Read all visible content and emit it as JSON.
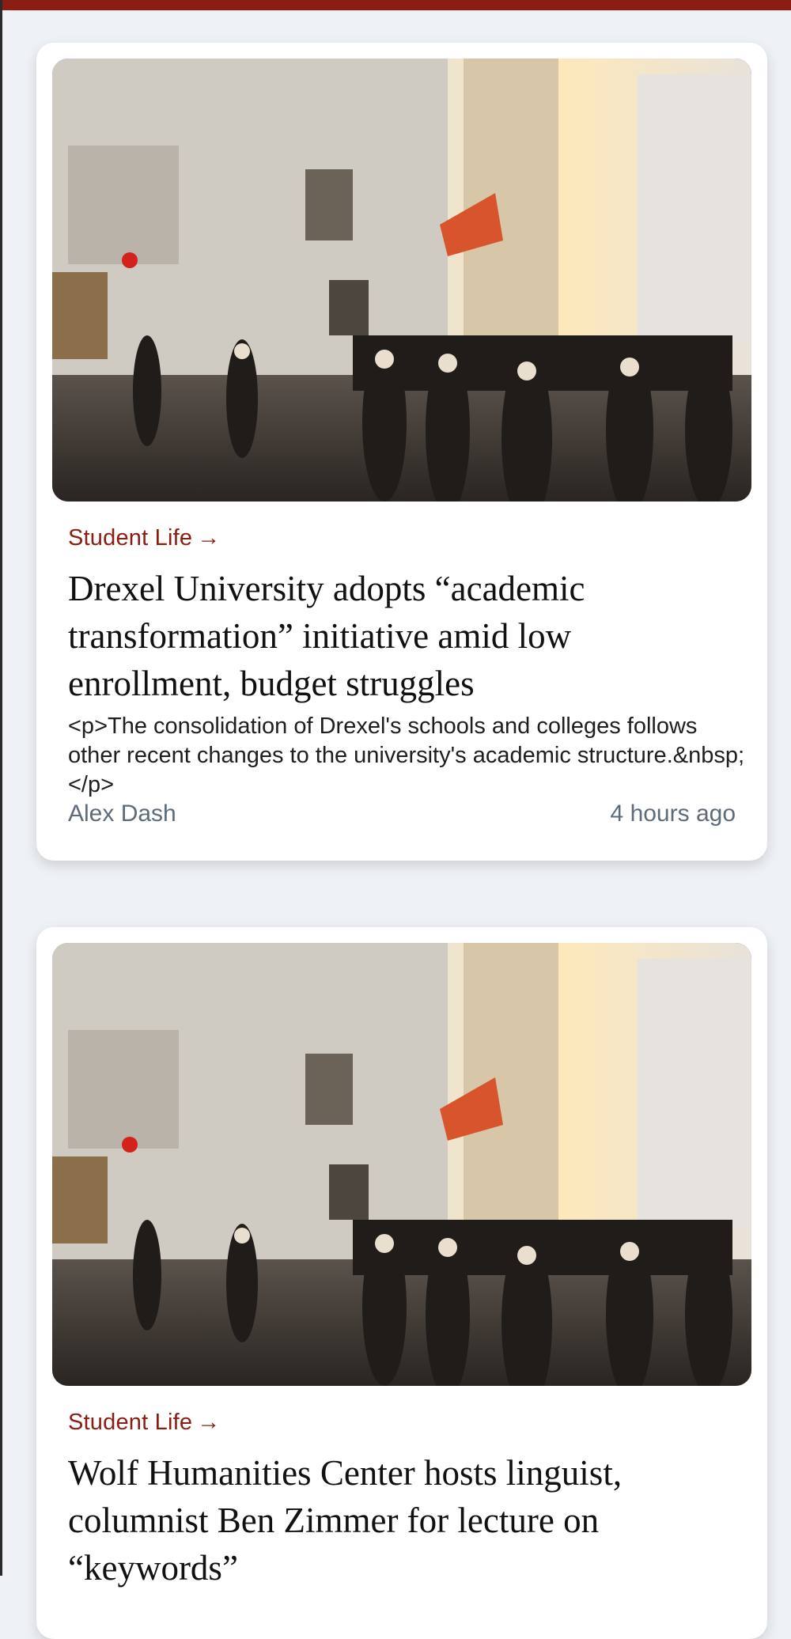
{
  "articles": [
    {
      "image_alt": "Crowd walking through a city street",
      "category": "Student Life",
      "category_arrow": "→",
      "title": "Drexel University adopts “academic transformation” initiative amid low enrollment, budget struggles",
      "excerpt": "<p>The consolidation of Drexel's schools and colleges follows other recent changes to the university's academic structure.&nbsp;</p>",
      "author": "Alex Dash",
      "timestamp": "4 hours ago"
    },
    {
      "image_alt": "Crowd walking through a city street",
      "category": "Student Life",
      "category_arrow": "→",
      "title": "Wolf Humanities Center hosts linguist, columnist Ben Zimmer for lecture on “keywords”"
    }
  ],
  "colors": {
    "accent": "#8b1d12",
    "meta": "#5d6b7a",
    "background": "#eef1f5"
  }
}
